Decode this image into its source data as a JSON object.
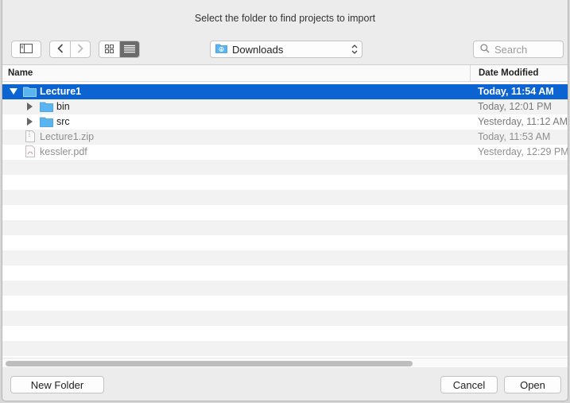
{
  "dialog": {
    "title": "Select the folder to find projects to import"
  },
  "toolbar": {
    "location": "Downloads",
    "search_placeholder": "Search",
    "view_mode": "list"
  },
  "columns": {
    "name": "Name",
    "date": "Date Modified"
  },
  "files": [
    {
      "name": "Lecture1",
      "date": "Today, 11:54 AM",
      "kind": "folder",
      "expanded": true,
      "selected": true,
      "level": 0
    },
    {
      "name": "bin",
      "date": "Today, 12:01 PM",
      "kind": "folder",
      "expanded": false,
      "level": 1
    },
    {
      "name": "src",
      "date": "Yesterday, 11:12 AM",
      "kind": "folder",
      "expanded": false,
      "level": 1
    },
    {
      "name": "Lecture1.zip",
      "date": "Today, 11:53 AM",
      "kind": "zip",
      "disabled": true,
      "level": 0
    },
    {
      "name": "kessler.pdf",
      "date": "Yesterday, 12:29 PM",
      "kind": "pdf",
      "disabled": true,
      "level": 0
    }
  ],
  "buttons": {
    "new_folder": "New Folder",
    "cancel": "Cancel",
    "open": "Open"
  },
  "colors": {
    "selection": "#0b64d1",
    "folder": "#5ab4f0"
  }
}
